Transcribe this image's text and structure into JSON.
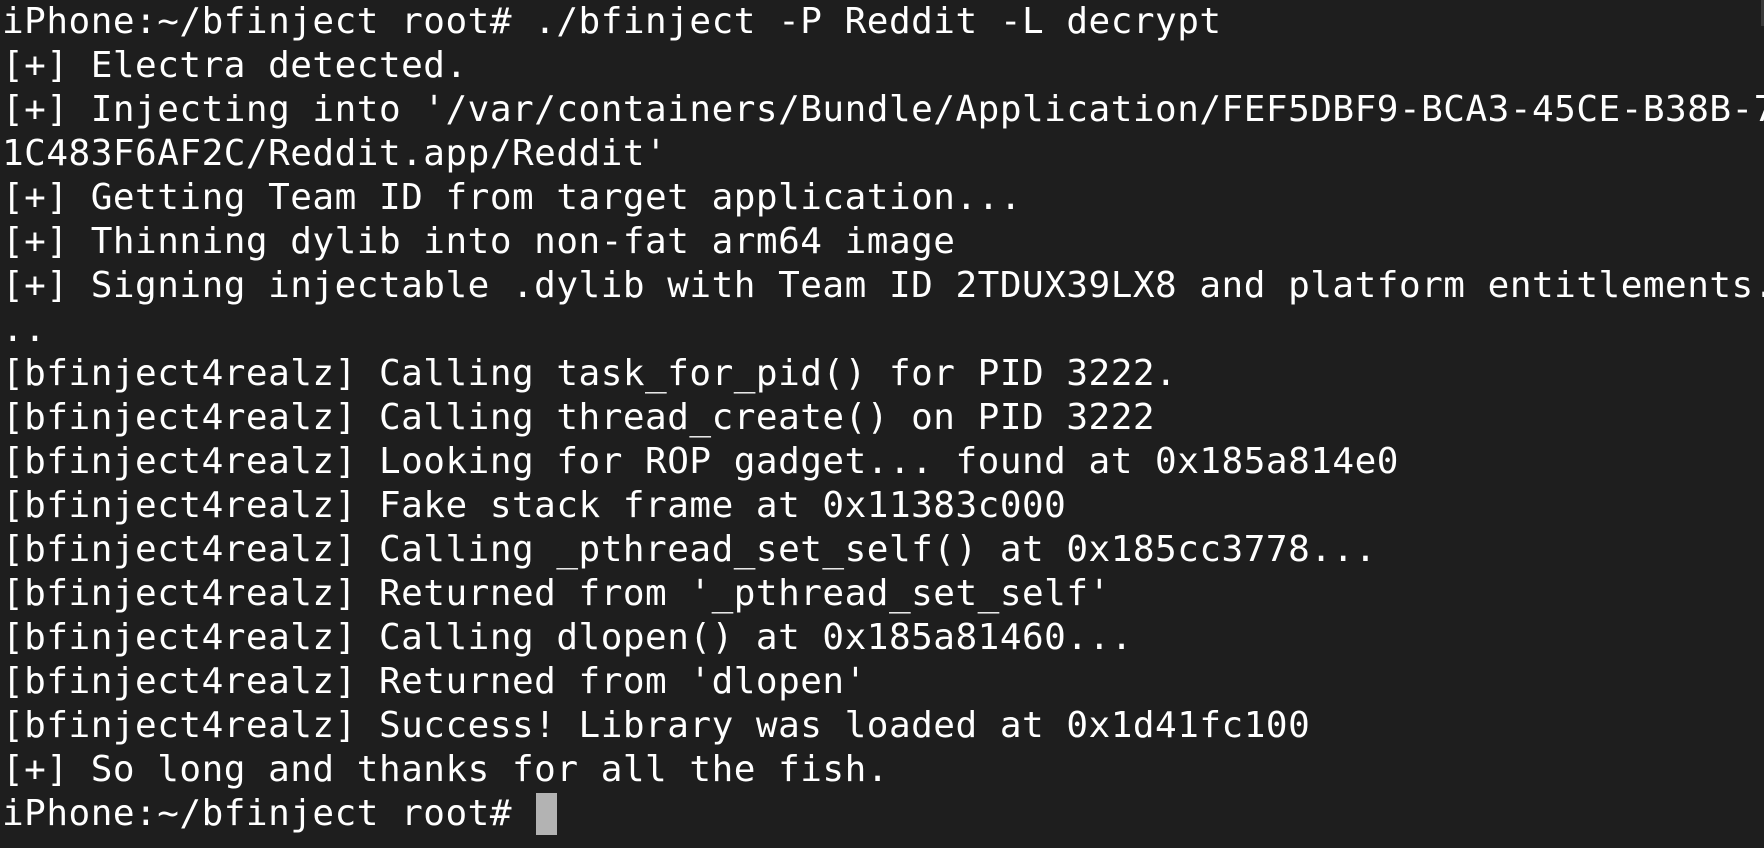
{
  "terminal": {
    "background": "#1e1e1e",
    "foreground": "#ffffff",
    "cursor_color": "#b3b3b3",
    "lines": [
      "iPhone:~/bfinject root# ./bfinject -P Reddit -L decrypt",
      "[+] Electra detected.",
      "[+] Injecting into '/var/containers/Bundle/Application/FEF5DBF9-BCA3-45CE-B38B-7",
      "1C483F6AF2C/Reddit.app/Reddit'",
      "[+] Getting Team ID from target application...",
      "[+] Thinning dylib into non-fat arm64 image",
      "[+] Signing injectable .dylib with Team ID 2TDUX39LX8 and platform entitlements.",
      "..",
      "[bfinject4realz] Calling task_for_pid() for PID 3222.",
      "[bfinject4realz] Calling thread_create() on PID 3222",
      "[bfinject4realz] Looking for ROP gadget... found at 0x185a814e0",
      "[bfinject4realz] Fake stack frame at 0x11383c000",
      "[bfinject4realz] Calling _pthread_set_self() at 0x185cc3778...",
      "[bfinject4realz] Returned from '_pthread_set_self'",
      "[bfinject4realz] Calling dlopen() at 0x185a81460...",
      "[bfinject4realz] Returned from 'dlopen'",
      "[bfinject4realz] Success! Library was loaded at 0x1d41fc100",
      "[+] So long and thanks for all the fish."
    ],
    "prompt": "iPhone:~/bfinject root# "
  }
}
